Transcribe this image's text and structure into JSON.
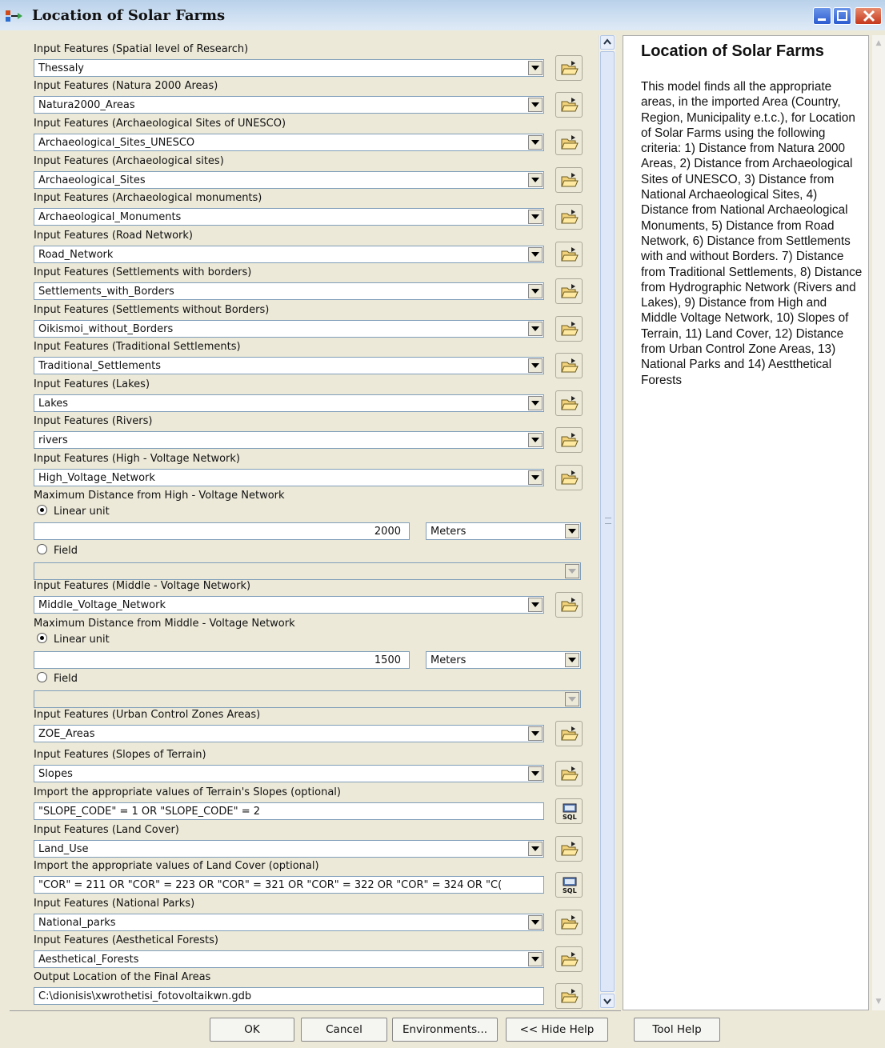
{
  "window": {
    "title": "Location of Solar Farms"
  },
  "fields": [
    {
      "label": "Input Features (Spatial level of Research)",
      "value": "Thessaly"
    },
    {
      "label": "Input Features (Natura 2000 Areas)",
      "value": "Natura2000_Areas"
    },
    {
      "label": "Input Features (Archaeological Sites of UNESCO)",
      "value": "Archaeological_Sites_UNESCO"
    },
    {
      "label": "Input Features (Archaeological sites)",
      "value": "Archaeological_Sites"
    },
    {
      "label": "Input Features (Archaeological monuments)",
      "value": "Archaeological_Monuments"
    },
    {
      "label": "Input Features (Road Network)",
      "value": "Road_Network"
    },
    {
      "label": "Input Features (Settlements with borders)",
      "value": "Settlements_with_Borders"
    },
    {
      "label": "Input Features (Settlements without Borders)",
      "value": "Oikismoi_without_Borders"
    },
    {
      "label": "Input Features (Traditional Settlements)",
      "value": "Traditional_Settlements"
    },
    {
      "label": "Input Features (Lakes)",
      "value": "Lakes"
    },
    {
      "label": "Input Features (Rivers)",
      "value": "rivers"
    },
    {
      "label": "Input Features (High - Voltage Network)",
      "value": "High_Voltage_Network"
    }
  ],
  "high_distance": {
    "label": "Maximum Distance from High - Voltage Network",
    "linear_label": "Linear unit",
    "value": "2000",
    "unit": "Meters",
    "field_label": "Field"
  },
  "middle_network": {
    "label": "Input Features (Middle - Voltage Network)",
    "value": "Middle_Voltage_Network"
  },
  "middle_distance": {
    "label": "Maximum Distance from Middle - Voltage Network",
    "linear_label": "Linear unit",
    "value": "1500",
    "unit": "Meters",
    "field_label": "Field"
  },
  "zoe": {
    "label": "Input Features (Urban Control Zones Areas)",
    "value": "ZOE_Areas"
  },
  "slopes": {
    "label": "Input Features (Slopes of Terrain)",
    "value": "Slopes"
  },
  "slopes_sql": {
    "label": "Import the appropriate values of Terrain's Slopes (optional)",
    "value": "\"SLOPE_CODE\" = 1 OR \"SLOPE_CODE\" = 2"
  },
  "land_cover": {
    "label": "Input Features (Land Cover)",
    "value": "Land_Use"
  },
  "land_sql": {
    "label": "Import the appropriate values of Land Cover (optional)",
    "value": "\"COR\" = 211 OR \"COR\" = 223 OR \"COR\" = 321 OR \"COR\" = 322 OR \"COR\" = 324 OR \"C("
  },
  "parks": {
    "label": "Input Features (National Parks)",
    "value": "National_parks"
  },
  "forests": {
    "label": "Input Features (Aesthetical Forests)",
    "value": "Aesthetical_Forests"
  },
  "output": {
    "label": "Output Location of the Final Areas",
    "value": "C:\\dionisis\\xwrothetisi_fotovoltaikwn.gdb"
  },
  "help": {
    "title": "Location of Solar Farms",
    "body": "This model finds all the appropriate areas, in the imported Area (Country, Region, Municipality e.t.c.), for Location of Solar Farms using the following criteria: 1) Distance from Natura 2000 Areas, 2) Distance from Archaeological Sites of UNESCO, 3) Distance from National Archaeological Sites, 4) Distance from National Archaeological Monuments, 5) Distance from Road Network, 6) Distance from Settlements with and without Borders. 7) Distance from Traditional Settlements, 8) Distance from Hydrographic Network (Rivers and Lakes), 9) Distance from High and Middle Voltage Network, 10) Slopes of Terrain, 11) Land Cover, 12) Distance from Urban Control Zone Areas, 13) National Parks and 14) Aestthetical Forests"
  },
  "buttons": {
    "ok": "OK",
    "cancel": "Cancel",
    "environments": "Environments...",
    "hide_help": "<< Hide Help",
    "tool_help": "Tool Help"
  },
  "icons": {
    "folder": "open-folder-icon",
    "sql": "sql-query-icon",
    "dropdown": "chevron-down-icon"
  }
}
